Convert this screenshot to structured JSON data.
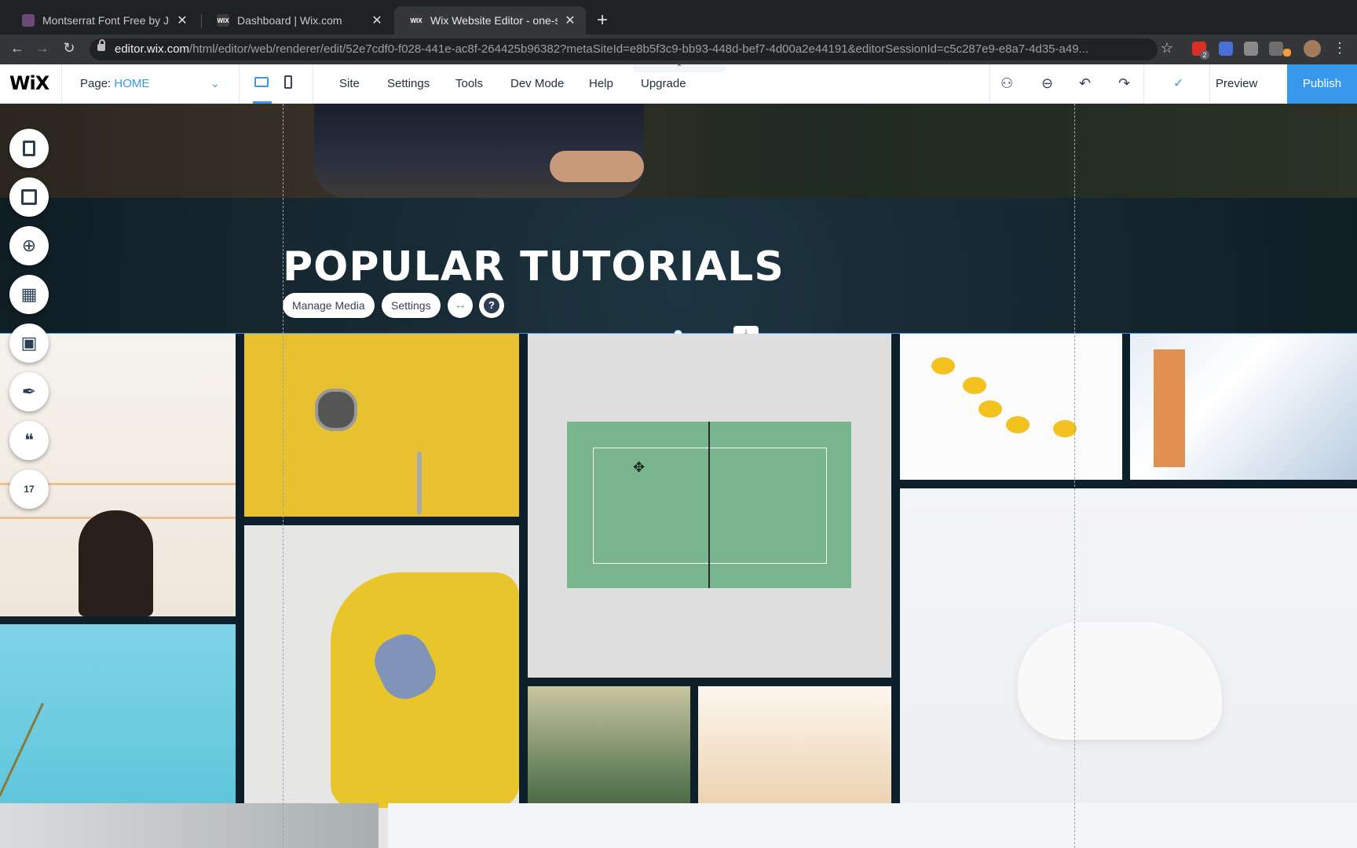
{
  "browser": {
    "tabs": [
      {
        "label": "Montserrat Font Free by Juliet",
        "active": false
      },
      {
        "label": "Dashboard | Wix.com",
        "active": false
      },
      {
        "label": "Wix Website Editor - one-skill",
        "active": true
      }
    ],
    "new_tab": "+",
    "url_host": "editor.wix.com",
    "url_path": "/html/editor/web/renderer/edit/52e7cdf0-f028-441e-ac8f-264425b96382?metaSiteId=e8b5f3c9-bb93-448d-bef7-4d00a2e44191&editorSessionId=c5c287e9-e8a7-4d35-a49...",
    "ext_badge": "2"
  },
  "editor": {
    "logo": "WiX",
    "page_label": "Page:",
    "page_value": "HOME",
    "menu": [
      "Site",
      "Settings",
      "Tools",
      "Dev Mode",
      "Help",
      "Upgrade"
    ],
    "preview": "Preview",
    "publish": "Publish",
    "accent_color": "#3899ec"
  },
  "canvas": {
    "heading": "POPULAR TUTORIALS",
    "toolbar": {
      "manage_media": "Manage Media",
      "settings": "Settings",
      "stretch_icon": "↔",
      "help_icon": "?"
    },
    "tiles": [
      "america-neon-photo",
      "yellow-door-photo",
      "tennis-court-photo",
      "lemons-photo",
      "building-photo",
      "sky-flowers-photo",
      "yellow-sofa-photo",
      "greenhouse-photo",
      "desert-photo",
      "arctic-fox-photo"
    ]
  },
  "left_panel": [
    "pages-icon",
    "background-icon",
    "add-icon",
    "apps-icon",
    "media-icon",
    "pen-icon",
    "chat-icon",
    "calendar-icon"
  ],
  "calendar_day": "17"
}
